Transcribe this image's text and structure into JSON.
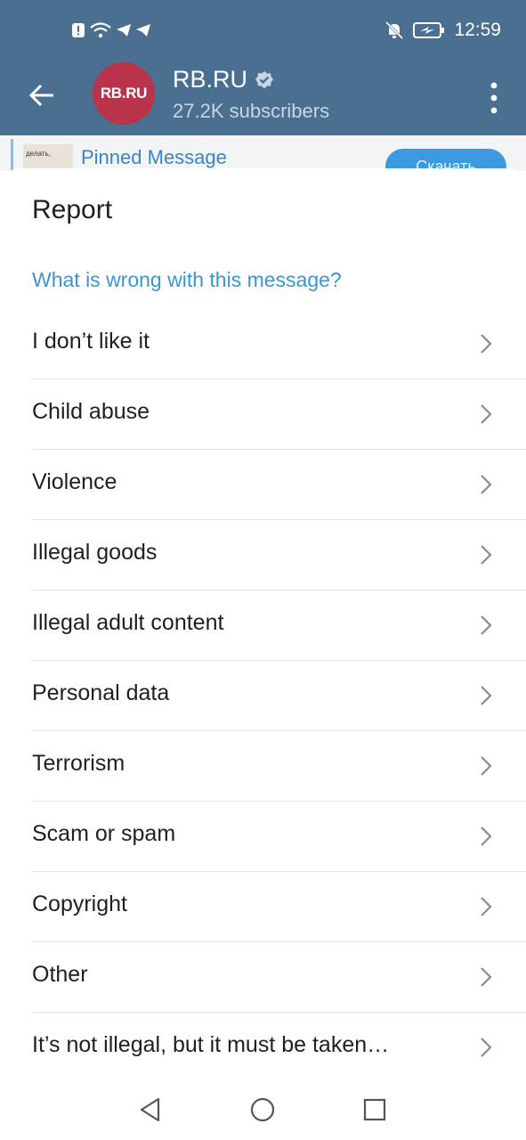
{
  "status_bar": {
    "time": "12:59",
    "icons_left": [
      "alert-icon",
      "wifi-icon",
      "telegram-icon",
      "telegram-icon"
    ],
    "icons_right": [
      "mute-bell-icon",
      "battery-charging-icon"
    ]
  },
  "header": {
    "channel_name": "RB.RU",
    "avatar_text": "RB.RU",
    "subscribers": "27.2K subscribers",
    "verified": true,
    "colors": {
      "bar": "#4a6f91",
      "avatar": "#b9344b"
    }
  },
  "pinned": {
    "title": "Pinned Message",
    "thumb_text": "делать,",
    "button_label": "Скачать"
  },
  "sheet": {
    "title": "Report",
    "subtitle": "What is wrong with this message?",
    "options": [
      "I don’t like it",
      "Child abuse",
      "Violence",
      "Illegal goods",
      "Illegal adult content",
      "Personal data",
      "Terrorism",
      "Scam or spam",
      "Copyright",
      "Other",
      "It’s not illegal, but it must be taken…"
    ],
    "accent_color": "#3a96cf"
  }
}
